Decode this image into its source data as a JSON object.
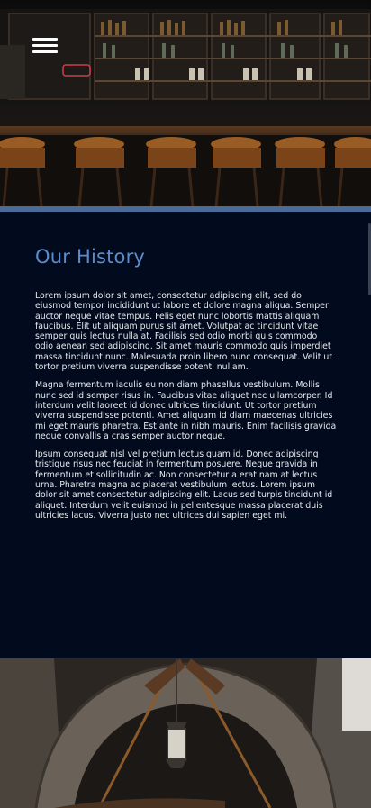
{
  "hero": {
    "photo_icon": "bar-interior-photo",
    "menu_icon": "hamburger-menu-icon"
  },
  "history": {
    "title": "Our History",
    "paragraphs": [
      "Lorem ipsum dolor sit amet, consectetur adipiscing elit, sed do eiusmod tempor incididunt ut labore et dolore magna aliqua. Semper auctor neque vitae tempus. Felis eget nunc lobortis mattis aliquam faucibus. Elit ut aliquam purus sit amet. Volutpat ac tincidunt vitae semper quis lectus nulla at. Facilisis sed odio morbi quis commodo odio aenean sed adipiscing. Sit amet mauris commodo quis imperdiet massa tincidunt nunc. Malesuada proin libero nunc consequat. Velit ut tortor pretium viverra suspendisse potenti nullam.",
      "Magna fermentum iaculis eu non diam phasellus vestibulum. Mollis nunc sed id semper risus in. Faucibus vitae aliquet nec ullamcorper. Id interdum velit laoreet id donec ultrices tincidunt. Ut tortor pretium viverra suspendisse potenti. Amet aliquam id diam maecenas ultricies mi eget mauris pharetra. Est ante in nibh mauris. Enim facilisis gravida neque convallis a cras semper auctor neque.",
      "Ipsum consequat nisl vel pretium lectus quam id. Donec adipiscing tristique risus nec feugiat in fermentum posuere. Neque gravida in fermentum et sollicitudin ac. Non consectetur a erat nam at lectus urna. Pharetra magna ac placerat vestibulum lectus. Lorem ipsum dolor sit amet consectetur adipiscing elit. Lacus sed turpis tincidunt id aliquet. Interdum velit euismod in pellentesque massa placerat duis ultricies lacus. Viverra justo nec ultrices dui sapien eget mi."
    ]
  },
  "bottom": {
    "photo_icon": "arched-doorway-lantern-photo"
  },
  "colors": {
    "section_bg": "#020b1d",
    "title": "#5b8ccf",
    "body_text": "#e7e9ee",
    "accent_strip": "#4a6a98"
  }
}
